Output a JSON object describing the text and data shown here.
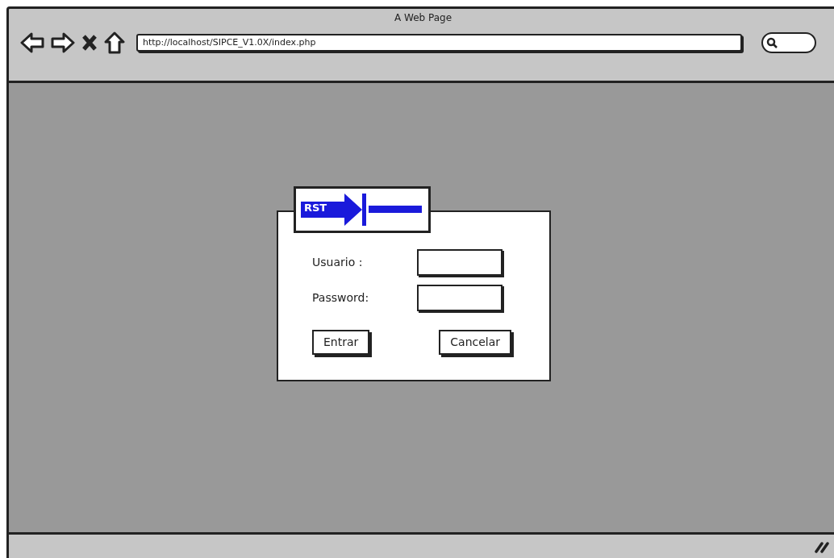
{
  "window": {
    "title": "A Web Page"
  },
  "browser": {
    "url": "http://localhost/SIPCE_V1.0X/index.php"
  },
  "login": {
    "logo_text": "RST",
    "fields": [
      {
        "label": "Usuario :"
      },
      {
        "label": "Password:"
      }
    ],
    "buttons": [
      "Entrar",
      "Cancelar"
    ]
  }
}
